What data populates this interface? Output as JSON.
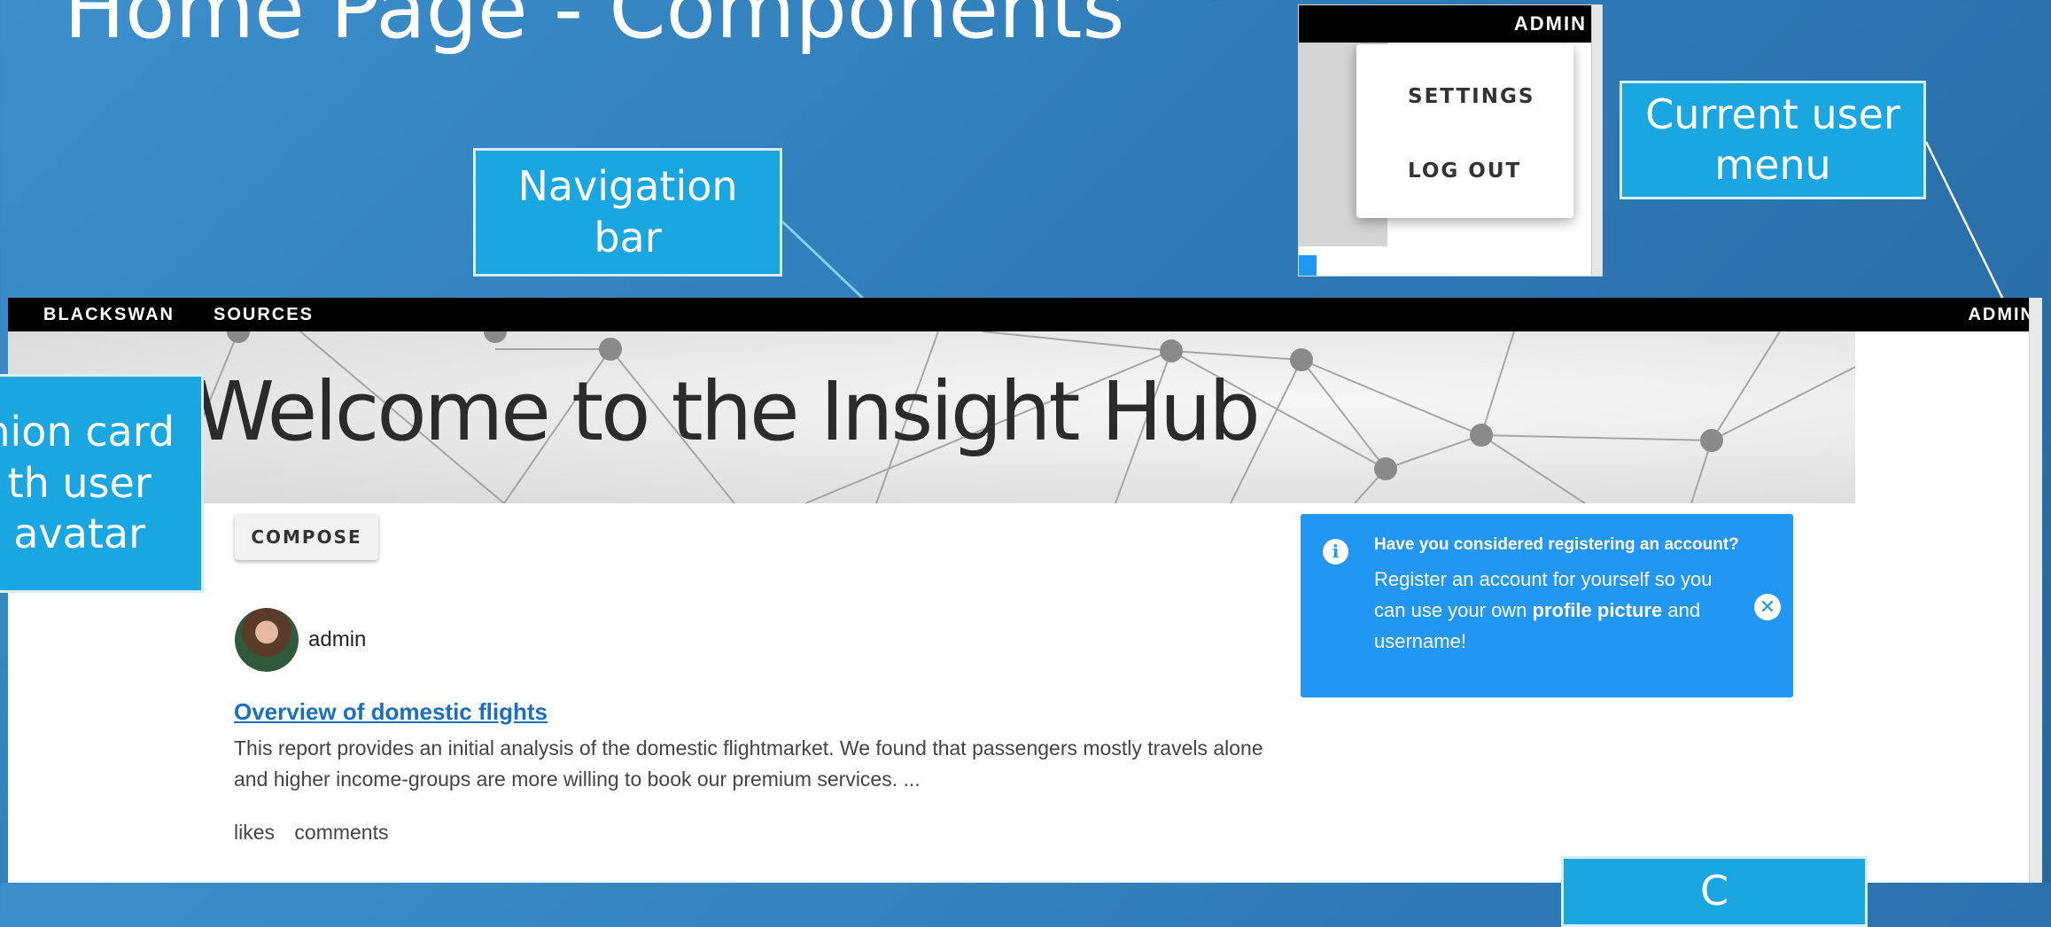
{
  "slide": {
    "title": "Home Page - Components"
  },
  "callouts": {
    "navigation": [
      "Navigation",
      "bar"
    ],
    "current_user": [
      "Current user",
      "menu"
    ],
    "opinion_card": [
      "nion card",
      "th user",
      "avatar"
    ],
    "close_partial": "C"
  },
  "inset": {
    "username": "ADMIN",
    "menu_items": [
      "SETTINGS",
      "LOG OUT"
    ]
  },
  "navbar": {
    "brand": "BLACKSWAN",
    "items": [
      "SOURCES"
    ],
    "user": "ADMIN"
  },
  "hero": {
    "title": "Welcome to the Insight Hub"
  },
  "compose_label": "COMPOSE",
  "post": {
    "author": "admin",
    "title": "Overview of domestic flights",
    "body": "This report provides an initial analysis of the domestic flightmarket. We found that passengers mostly travels alone and higher income-groups are more willing to book our premium services. ...",
    "likes_label": "likes",
    "comments_label": "comments"
  },
  "alert": {
    "icon": "info-icon",
    "heading": "Have you considered registering an account?",
    "body_before": "Register an account for yourself so you can use your own ",
    "body_bold": "profile picture",
    "body_after": " and username!",
    "close_icon": "close-icon"
  },
  "colors": {
    "callout": "#1aa6e0",
    "alert": "#2196f3",
    "link": "#1a6fc4",
    "navbar": "#000000"
  }
}
